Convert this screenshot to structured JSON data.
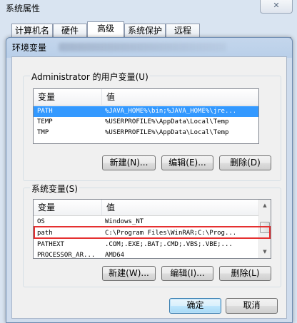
{
  "system_props": {
    "title": "系统属性",
    "close_glyph": "✕",
    "tabs": [
      {
        "label": "计算机名"
      },
      {
        "label": "硬件"
      },
      {
        "label": "高级"
      },
      {
        "label": "系统保护"
      },
      {
        "label": "远程"
      }
    ]
  },
  "env_dialog": {
    "title": "环境变量",
    "user_vars": {
      "label": "Administrator 的用户变量(U)",
      "columns": [
        "变量",
        "值"
      ],
      "rows": [
        {
          "name": "PATH",
          "value": "%JAVA_HOME%\\bin;%JAVA_HOME%\\jre...",
          "selected": true
        },
        {
          "name": "TEMP",
          "value": "%USERPROFILE%\\AppData\\Local\\Temp",
          "selected": false
        },
        {
          "name": "TMP",
          "value": "%USERPROFILE%\\AppData\\Local\\Temp",
          "selected": false
        }
      ],
      "buttons": {
        "new": "新建(N)...",
        "edit": "编辑(E)...",
        "delete": "删除(D)"
      }
    },
    "sys_vars": {
      "label": "系统变量(S)",
      "columns": [
        "变量",
        "值"
      ],
      "rows": [
        {
          "name": "OS",
          "value": "Windows_NT"
        },
        {
          "name": "path",
          "value": "C:\\Program Files\\WinRAR;C:\\Prog..."
        },
        {
          "name": "PATHEXT",
          "value": ".COM;.EXE;.BAT;.CMD;.VBS;.VBE;..."
        },
        {
          "name": "PROCESSOR_AR...",
          "value": "AMD64"
        }
      ],
      "buttons": {
        "new": "新建(W)...",
        "edit": "编辑(I)...",
        "delete": "删除(L)"
      }
    },
    "ok": "确定",
    "cancel": "取消"
  },
  "colors": {
    "selection": "#3399ff",
    "highlight_box": "#e53030"
  }
}
